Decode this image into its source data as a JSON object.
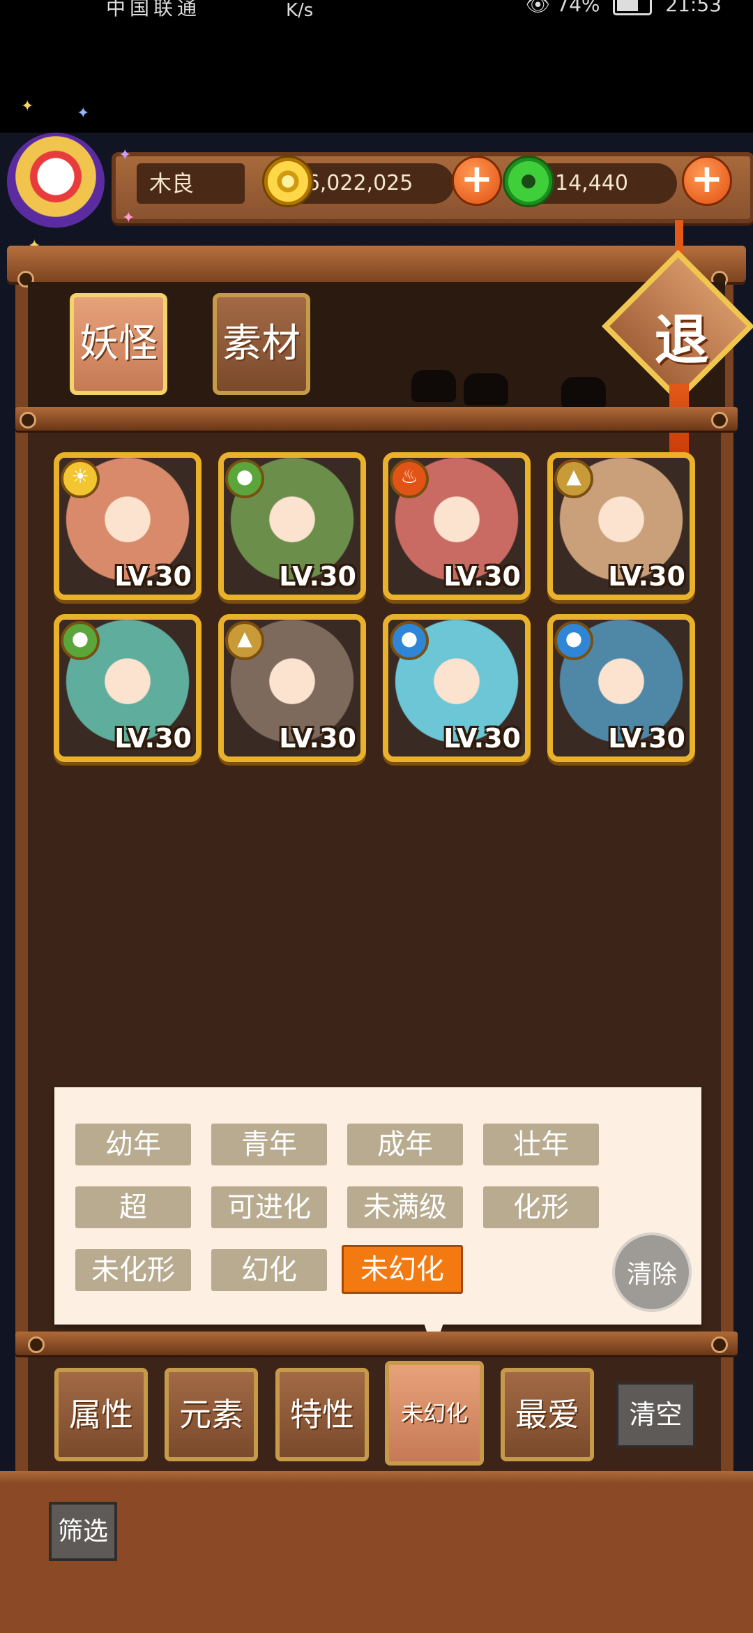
{
  "status_bar": {
    "carrier": "中国联通",
    "speed": "K/s",
    "battery": "74%",
    "time": "21:53"
  },
  "player": {
    "name": "木良",
    "gold": "6,022,025",
    "jade": "14,440"
  },
  "top_tabs": [
    {
      "label": "妖怪",
      "active": true
    },
    {
      "label": "素材",
      "active": false
    }
  ],
  "exit_label": "退",
  "cards": [
    {
      "element": "light",
      "level": "LV.30",
      "color": "#d98a6a"
    },
    {
      "element": "wood",
      "level": "LV.30",
      "color": "#6b8f4a"
    },
    {
      "element": "fire",
      "level": "LV.30",
      "color": "#c96b63"
    },
    {
      "element": "earth",
      "level": "LV.30",
      "color": "#c9a07a"
    },
    {
      "element": "wood",
      "level": "LV.30",
      "color": "#5fae9d"
    },
    {
      "element": "earth",
      "level": "LV.30",
      "color": "#7d6a5c"
    },
    {
      "element": "water",
      "level": "LV.30",
      "color": "#6cc6d6"
    },
    {
      "element": "water",
      "level": "LV.30",
      "color": "#4e88a6"
    }
  ],
  "filters": {
    "row1": [
      "幼年",
      "青年",
      "成年",
      "壮年"
    ],
    "row2": [
      "超",
      "可进化",
      "未满级",
      "化形"
    ],
    "row3": [
      "未化形",
      "幻化",
      "未幻化"
    ],
    "active": "未幻化",
    "clear_label": "清除"
  },
  "bottom_tabs": [
    "属性",
    "元素",
    "特性",
    "未幻化",
    "最爱"
  ],
  "bottom_active": "未幻化",
  "clear_all_label": "清空",
  "filter_button_label": "筛选",
  "colors": {
    "accent": "#f37a10",
    "wood_frame": "#7a4321",
    "card_border": "#e9b22a"
  }
}
